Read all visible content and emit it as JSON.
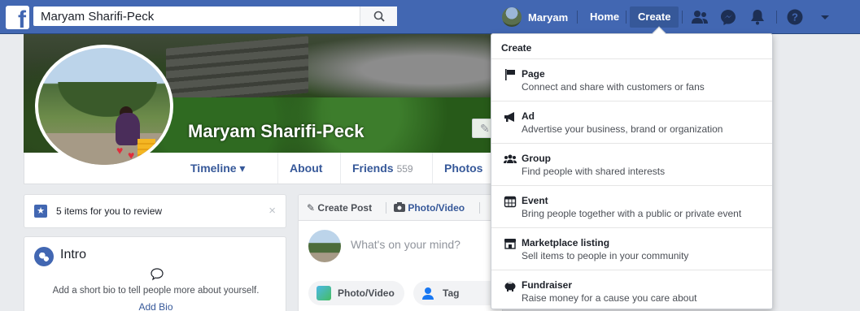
{
  "topbar": {
    "logo": "f",
    "search_value": "Maryam Sharifi-Peck",
    "user_name": "Maryam",
    "home_label": "Home",
    "create_label": "Create",
    "icons": [
      "friends-icon",
      "messenger-icon",
      "notifications-icon",
      "help-icon",
      "caret-down-icon"
    ],
    "brand_color": "#4267b2"
  },
  "profile": {
    "name": "Maryam Sharifi-Peck",
    "nav": {
      "timeline": "Timeline ▾",
      "about": "About",
      "friends": "Friends",
      "friends_count": "559",
      "photos": "Photos"
    }
  },
  "review": {
    "text": "5 items for you to review",
    "close": "×"
  },
  "intro": {
    "title": "Intro",
    "text": "Add a short bio to tell people more about yourself.",
    "link": "Add Bio"
  },
  "composer": {
    "tab_create": "Create Post",
    "tab_photo": "Photo/Video",
    "placeholder": "What's on your mind?",
    "btn_photo": "Photo/Video",
    "btn_tag": "Tag Friends"
  },
  "create_menu": {
    "header": "Create",
    "items": [
      {
        "title": "Page",
        "desc": "Connect and share with customers or fans",
        "icon": "flag-icon"
      },
      {
        "title": "Ad",
        "desc": "Advertise your business, brand or organization",
        "icon": "megaphone-icon"
      },
      {
        "title": "Group",
        "desc": "Find people with shared interests",
        "icon": "group-icon"
      },
      {
        "title": "Event",
        "desc": "Bring people together with a public or private event",
        "icon": "calendar-icon"
      },
      {
        "title": "Marketplace listing",
        "desc": "Sell items to people in your community",
        "icon": "storefront-icon"
      },
      {
        "title": "Fundraiser",
        "desc": "Raise money for a cause you care about",
        "icon": "piggy-bank-icon"
      }
    ]
  }
}
